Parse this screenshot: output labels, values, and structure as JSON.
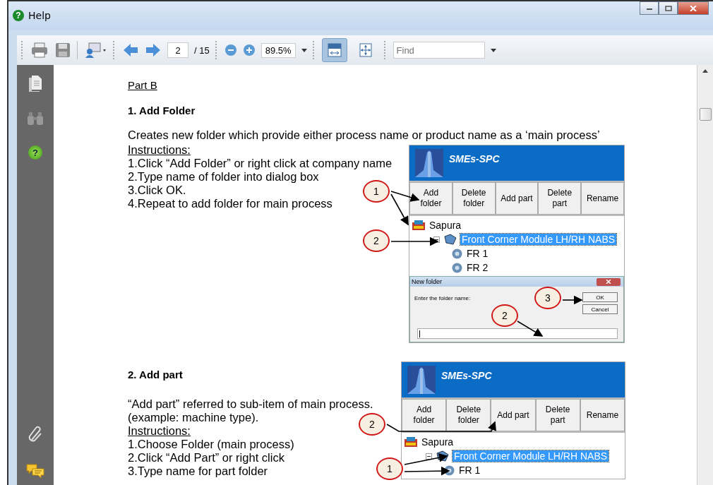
{
  "window": {
    "title": "Help",
    "icon_glyph": "?"
  },
  "toolbar": {
    "page": "2",
    "page_total": "/ 15",
    "zoom": "89.5%",
    "find_placeholder": "Find",
    "view_modes": [
      {
        "kind": "fit-width",
        "selected": true
      },
      {
        "kind": "fit-page",
        "selected": false
      }
    ]
  },
  "side_panel": {
    "help_glyph": "?"
  },
  "sections": [
    {
      "part_label": "Part B",
      "heading": "1. Add Folder",
      "intro": [
        "Creates new folder which provide either process name or product name as a ‘main process’"
      ],
      "instructions_label": "Instructions:",
      "steps": [
        "1.Click “Add Folder” or right click at company name",
        "2.Type name of folder into dialog box",
        "3.Click OK.",
        "4.Repeat to add folder for main process"
      ],
      "figure": {
        "app_title": "SMEs-SPC",
        "buttons": [
          [
            "Add",
            "folder"
          ],
          [
            "Delete",
            "folder"
          ],
          [
            "Add part"
          ],
          [
            "Delete",
            "part"
          ],
          [
            "Rename"
          ]
        ],
        "tree": [
          {
            "label": "Sapura",
            "kind": "company",
            "selected": false,
            "children": [
              {
                "label": "Front Corner Module LH/RH NABS",
                "kind": "folder",
                "selected": true,
                "expanded": true,
                "children": [
                  {
                    "label": "FR 1",
                    "kind": "part",
                    "selected": false
                  },
                  {
                    "label": "FR 2",
                    "kind": "part",
                    "selected": false
                  }
                ]
              }
            ]
          }
        ],
        "dialog": {
          "title": "New folder",
          "prompt": "Enter the folder name:",
          "ok": "OK",
          "cancel": "Cancel"
        },
        "callouts": [
          "1",
          "2",
          "3",
          "2"
        ]
      }
    },
    {
      "heading": "2.  Add part",
      "intro": [
        "“Add part” referred to sub-item of main process.",
        " (example: machine type)."
      ],
      "instructions_label": "Instructions:",
      "steps": [
        "1.Choose Folder (main process)",
        "2.Click “Add Part” or right click",
        "3.Type name for part folder"
      ],
      "figure": {
        "app_title": "SMEs-SPC",
        "buttons": [
          [
            "Add",
            "folder"
          ],
          [
            "Delete",
            "folder"
          ],
          [
            "Add part"
          ],
          [
            "Delete",
            "part"
          ],
          [
            "Rename"
          ]
        ],
        "tree": [
          {
            "label": "Sapura",
            "kind": "company",
            "selected": false,
            "children": [
              {
                "label": "Front Corner Module LH/RH NABS",
                "kind": "folder",
                "selected": true,
                "expanded": true,
                "children": [
                  {
                    "label": "FR 1",
                    "kind": "part",
                    "selected": false
                  }
                ]
              }
            ]
          }
        ],
        "callouts": [
          "2",
          "1"
        ]
      }
    }
  ]
}
